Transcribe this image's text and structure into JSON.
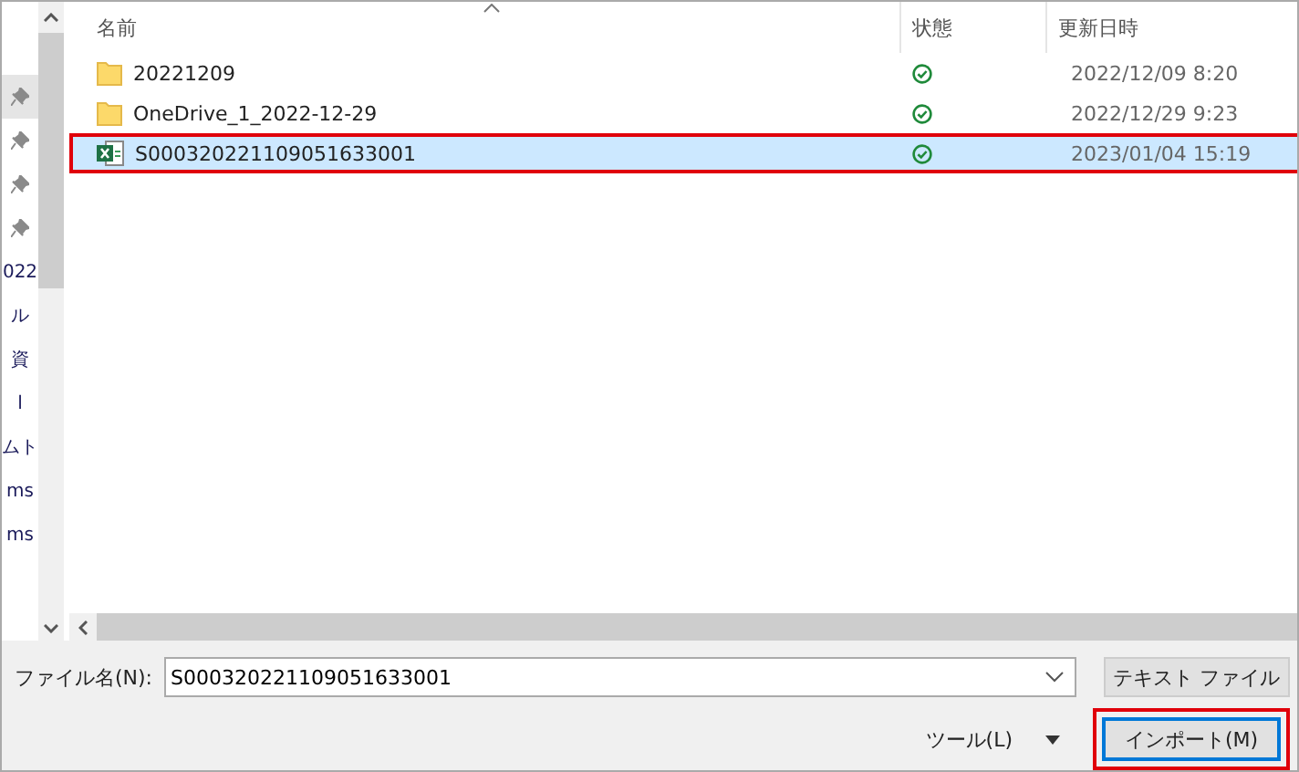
{
  "nav": {
    "items": [
      {
        "kind": "pin",
        "selected": true
      },
      {
        "kind": "pin",
        "selected": false
      },
      {
        "kind": "pin",
        "selected": false
      },
      {
        "kind": "pin",
        "selected": false
      },
      {
        "kind": "text",
        "label": "022",
        "selected": false
      },
      {
        "kind": "text",
        "label": "ル",
        "selected": false
      },
      {
        "kind": "text",
        "label": "資",
        "selected": false
      },
      {
        "kind": "text",
        "label": "l",
        "selected": false
      },
      {
        "kind": "text",
        "label": "ムト",
        "selected": false
      },
      {
        "kind": "text",
        "label": "ms",
        "selected": false
      },
      {
        "kind": "text",
        "label": "ms",
        "selected": false
      }
    ]
  },
  "table": {
    "columns": [
      "名前",
      "状態",
      "更新日時"
    ],
    "rows": [
      {
        "kind": "folder",
        "name": "20221209",
        "synced": true,
        "date": "2022/12/09 8:20",
        "selected": false,
        "highlighted": false
      },
      {
        "kind": "folder",
        "name": "OneDrive_1_2022-12-29",
        "synced": true,
        "date": "2022/12/29 9:23",
        "selected": false,
        "highlighted": false
      },
      {
        "kind": "excel",
        "name": "S000320221109051633001",
        "synced": true,
        "date": "2023/01/04 15:19",
        "selected": true,
        "highlighted": true
      }
    ]
  },
  "filename": {
    "label": "ファイル名(N):",
    "value": "S000320221109051633001"
  },
  "filetype": {
    "value": "テキスト ファイル"
  },
  "tools": {
    "label": "ツール(L)"
  },
  "import_button": {
    "label": "インポート(M)",
    "highlighted": true
  }
}
